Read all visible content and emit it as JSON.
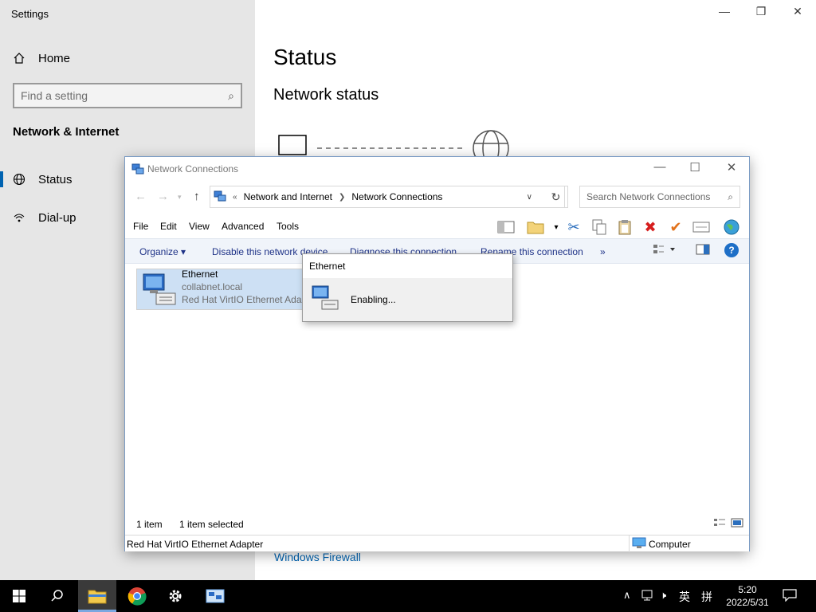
{
  "settings": {
    "title": "Settings",
    "home_label": "Home",
    "search_placeholder": "Find a setting",
    "section_heading": "Network & Internet",
    "nav": [
      {
        "label": "Status",
        "icon": "globe-icon"
      },
      {
        "label": "Dial-up",
        "icon": "dialup-icon"
      }
    ],
    "page_title": "Status",
    "page_subtitle": "Network status",
    "firewall_link": "Windows Firewall"
  },
  "nc_window": {
    "title": "Network Connections",
    "address": {
      "prefix": "«",
      "crumbs": [
        "Network and Internet",
        "Network Connections"
      ]
    },
    "search_placeholder": "Search Network Connections",
    "menu": [
      "File",
      "Edit",
      "View",
      "Advanced",
      "Tools"
    ],
    "commands": {
      "organize": "Organize",
      "disable": "Disable this network device",
      "diagnose": "Diagnose this connection",
      "rename": "Rename this connection",
      "more": "»"
    },
    "item": {
      "name": "Ethernet",
      "domain": "collabnet.local",
      "adapter": "Red Hat VirtIO Ethernet Adapter"
    },
    "status": {
      "count": "1 item",
      "selected": "1 item selected"
    },
    "details": {
      "adapter": "Red Hat VirtIO Ethernet Adapter",
      "location": "Computer"
    }
  },
  "popup": {
    "title": "Ethernet",
    "message": "Enabling..."
  },
  "taskbar": {
    "time": "5:20",
    "date": "2022/5/31",
    "ime": "英",
    "ime_mode": "拼"
  }
}
